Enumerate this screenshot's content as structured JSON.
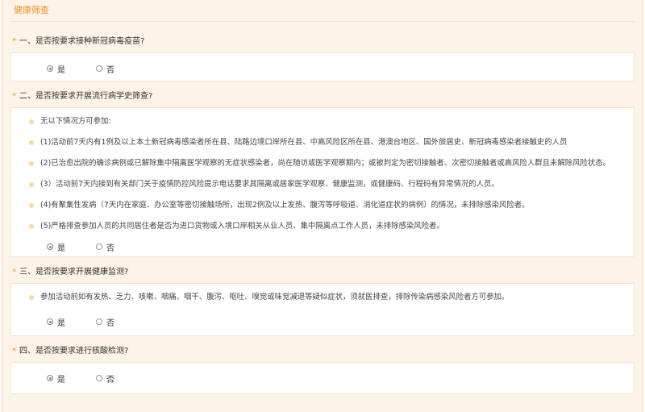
{
  "section": {
    "title": "健康筛查"
  },
  "required_mark": "*",
  "questions": [
    {
      "label": "一、是否按要求接种新冠病毒疫苗?",
      "bullets": [],
      "options": [
        {
          "label": "是",
          "checked": true
        },
        {
          "label": "否",
          "checked": false
        }
      ]
    },
    {
      "label": "二、是否按要求开展流行病学史筛查?",
      "bullets": [
        "无以下情况方可参加:",
        "(1)活动前7天内有1例及以上本土新冠病毒感染者所在县、陆路边境口岸所在县、中高风险区所在县、港澳台地区、国外旅居史、新冠病毒感染者接触史的人员",
        "(2)已治愈出院的确诊病例或已解除集中隔离医学观察的无症状感染者，尚在随访或医学观察期内；或被判定为密切接触者、次密切接触者或高风险人群且未解除风险状态。",
        "(3）活动前7天内接到有关部门关于疫情防控风险提示电话要求其隔离或居家医学观察、健康监测，或健康码、行程码有异常情况的人员。",
        "(4)有聚集性发病（7天内在家庭、办公室等密切接触场所，出现2例及以上发热、腹泻等呼吸道、消化道症状的病例）的情况，未排除感染风险者。",
        "(5)严格排查参加人员的共同居住者是否为进口货物或入境口岸相关从业人员、集中隔离点工作人员，未排除感染风险者。"
      ],
      "options": [
        {
          "label": "是",
          "checked": true
        },
        {
          "label": "否",
          "checked": false
        }
      ]
    },
    {
      "label": "三、是否按要求开展健康监测?",
      "bullets": [
        "参加活动前如有发热、乏力、咳嗽、咽痛、咽干、腹泻、呕吐、嗅觉或味觉减退等疑似症状，须就医排查，排除传染病感染风险者方可参加。"
      ],
      "options": [
        {
          "label": "是",
          "checked": true
        },
        {
          "label": "否",
          "checked": false
        }
      ]
    },
    {
      "label": "四、是否按要求进行核酸检测?",
      "bullets": [],
      "options": [
        {
          "label": "是",
          "checked": true
        },
        {
          "label": "否",
          "checked": false
        }
      ]
    }
  ]
}
